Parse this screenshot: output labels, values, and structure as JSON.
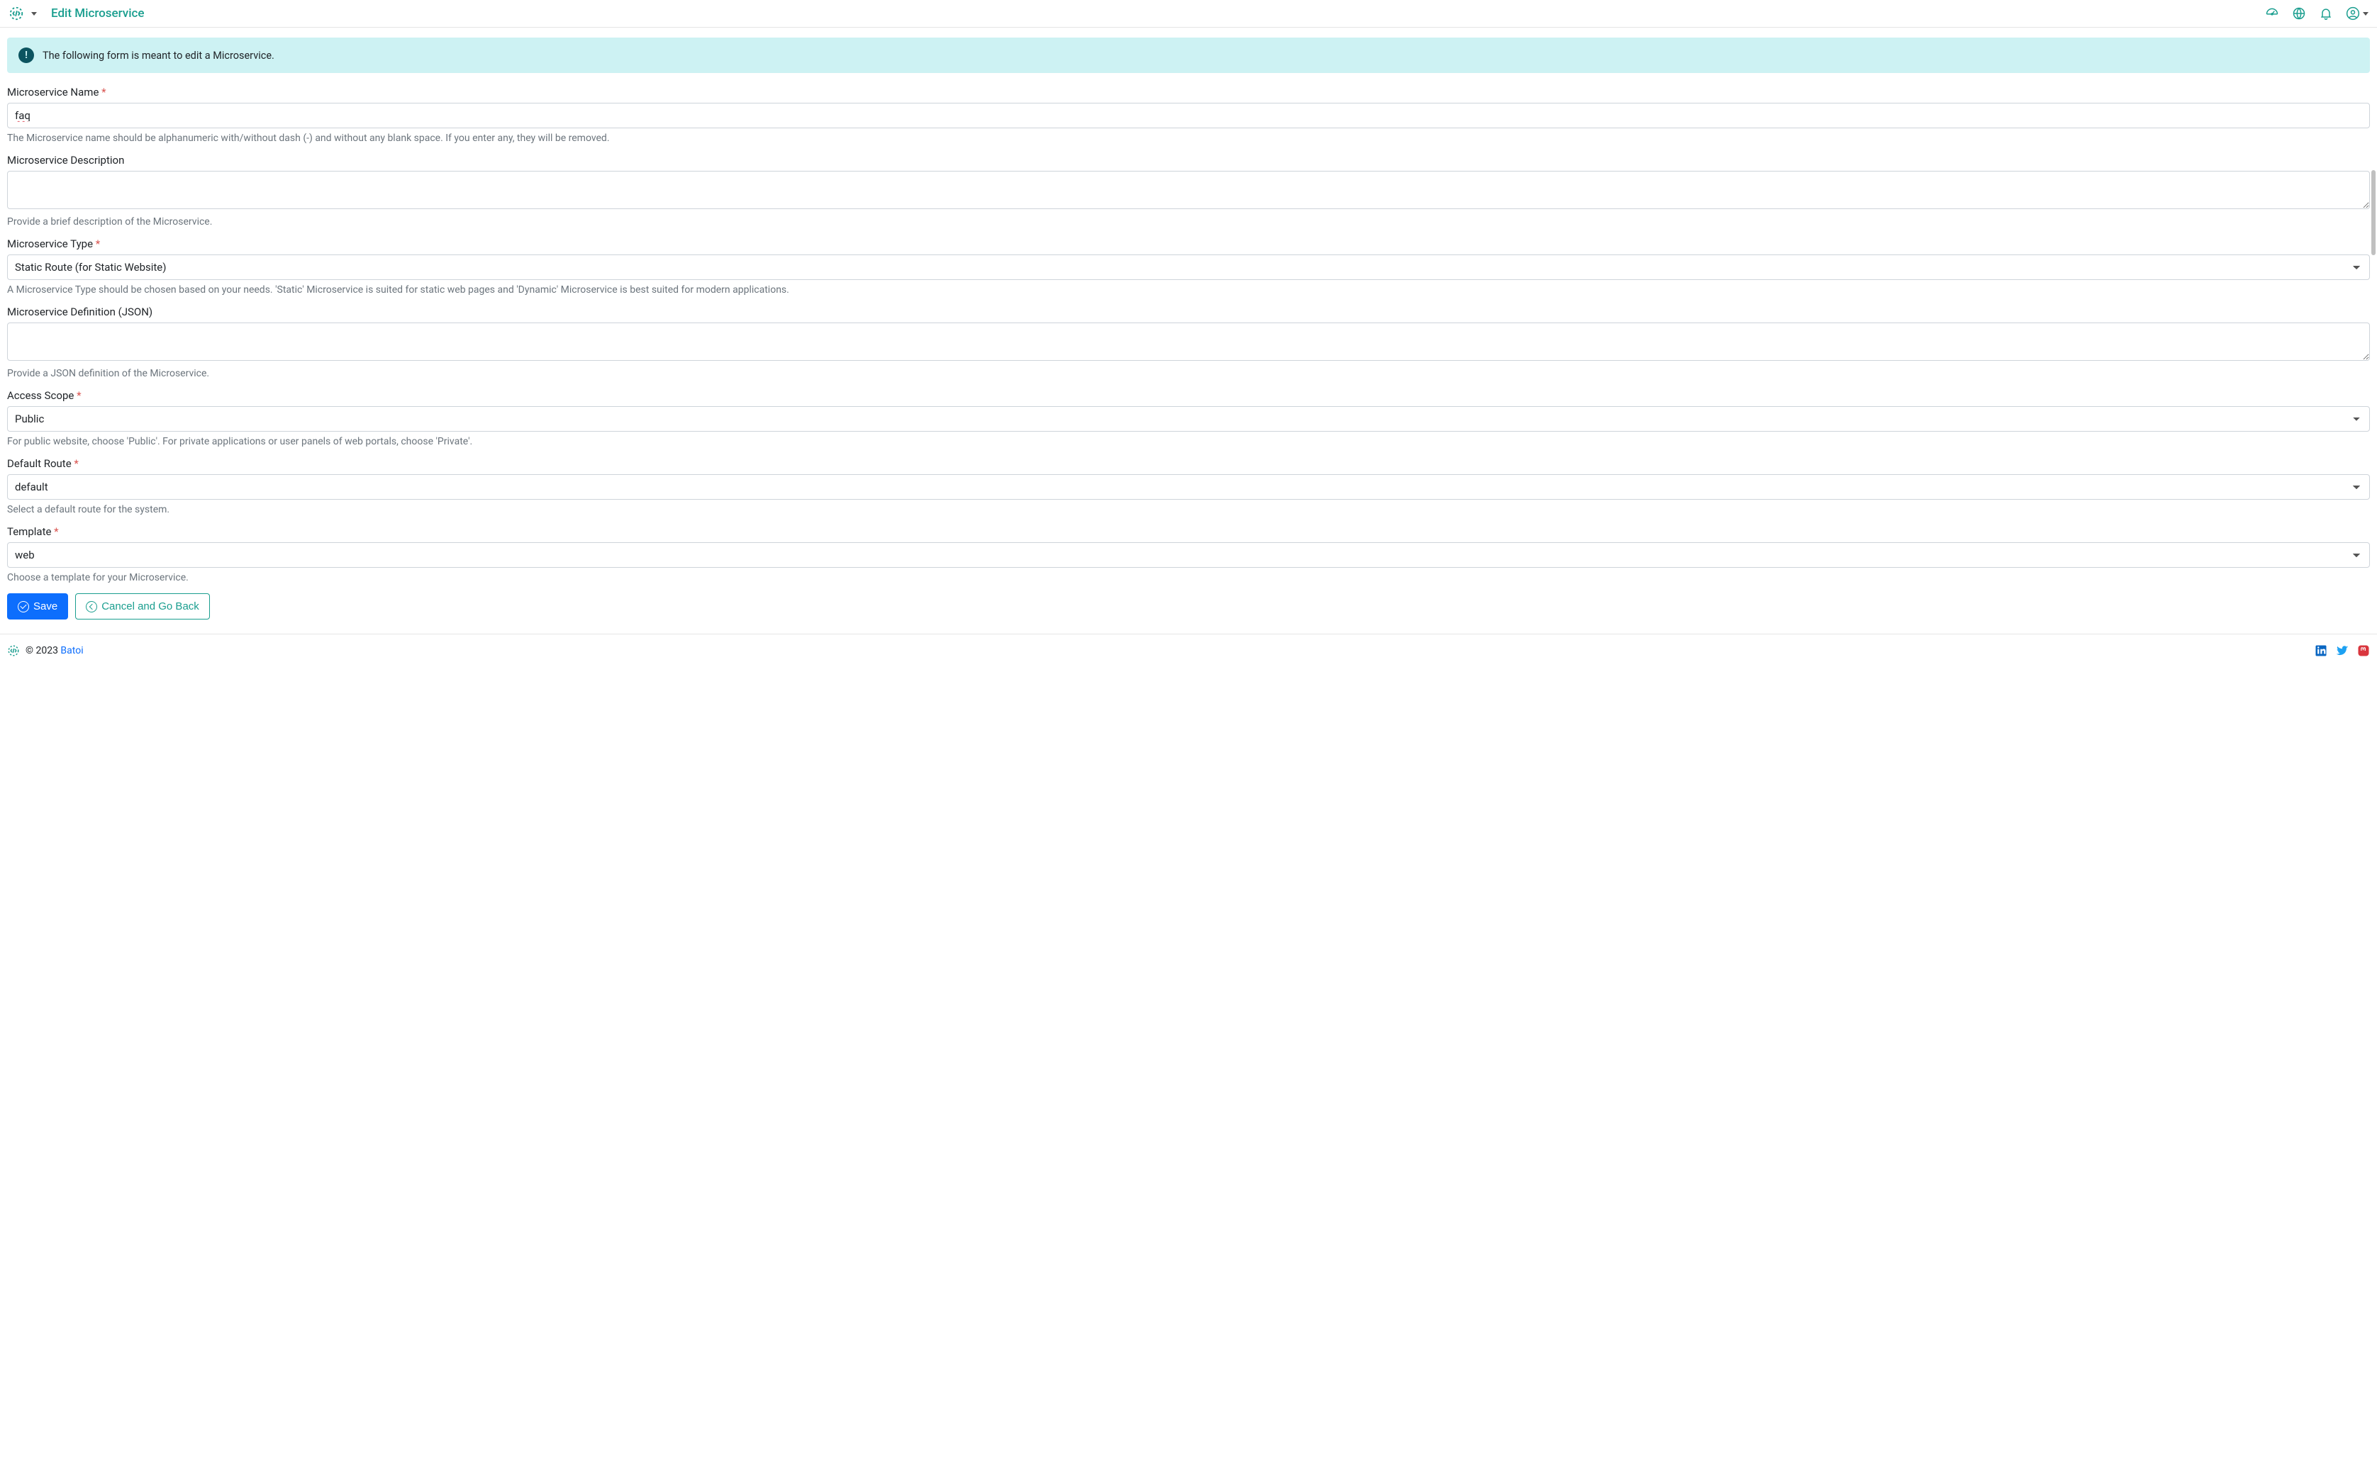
{
  "header": {
    "title": "Edit Microservice"
  },
  "alert": {
    "text": "The following form is meant to edit a Microservice."
  },
  "fields": {
    "name": {
      "label": "Microservice Name",
      "value": "faq",
      "help": "The Microservice name should be alphanumeric with/without dash (-) and without any blank space. If you enter any, they will be removed."
    },
    "description": {
      "label": "Microservice Description",
      "value": "",
      "help": "Provide a brief description of the Microservice."
    },
    "type": {
      "label": "Microservice Type",
      "value": "Static Route (for Static Website)",
      "help": "A Microservice Type should be chosen based on your needs. 'Static' Microservice is suited for static web pages and 'Dynamic' Microservice is best suited for modern applications."
    },
    "definition": {
      "label": "Microservice Definition (JSON)",
      "value": "",
      "help": "Provide a JSON definition of the Microservice."
    },
    "access_scope": {
      "label": "Access Scope",
      "value": "Public",
      "help": "For public website, choose 'Public'. For private applications or user panels of web portals, choose 'Private'."
    },
    "default_route": {
      "label": "Default Route",
      "value": "default",
      "help": "Select a default route for the system."
    },
    "template": {
      "label": "Template",
      "value": "web",
      "help": "Choose a template for your Microservice."
    }
  },
  "buttons": {
    "save": "Save",
    "cancel": "Cancel and Go Back"
  },
  "footer": {
    "copyright": "© 2023 ",
    "brand": "Batoi"
  }
}
